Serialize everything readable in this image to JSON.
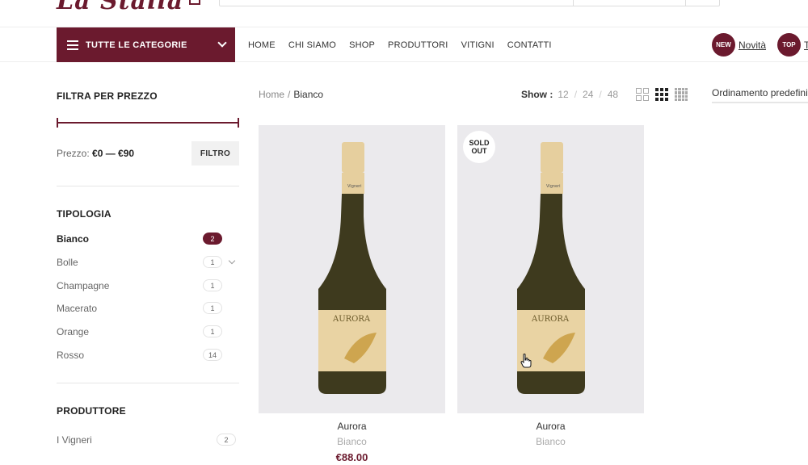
{
  "header": {
    "logo_text": "La Stalla"
  },
  "nav": {
    "categories_label": "TUTTE LE CATEGORIE",
    "menu": [
      "HOME",
      "CHI SIAMO",
      "SHOP",
      "PRODUTTORI",
      "VITIGNI",
      "CONTATTI"
    ],
    "badges": [
      {
        "icon_text": "NEW",
        "label": "Novità"
      },
      {
        "icon_text": "TOP",
        "label": "T"
      }
    ]
  },
  "sidebar": {
    "price_filter": {
      "title": "FILTRA PER PREZZO",
      "label": "Prezzo:",
      "range": "€0 — €90",
      "button": "FILTRO"
    },
    "tipologia": {
      "title": "TIPOLOGIA",
      "items": [
        {
          "label": "Bianco",
          "count": "2",
          "active": true
        },
        {
          "label": "Bolle",
          "count": "1"
        },
        {
          "label": "Champagne",
          "count": "1"
        },
        {
          "label": "Macerato",
          "count": "1"
        },
        {
          "label": "Orange",
          "count": "1"
        },
        {
          "label": "Rosso",
          "count": "14"
        }
      ]
    },
    "produttore": {
      "title": "PRODUTTORE",
      "items": [
        {
          "label": "I Vigneri",
          "count": "2"
        }
      ]
    }
  },
  "toolbar": {
    "breadcrumb_home": "Home",
    "breadcrumb_separator": "/",
    "breadcrumb_current": "Bianco",
    "show_label": "Show :",
    "show_options": [
      "12",
      "24",
      "48"
    ],
    "sort_label": "Ordinamento predefinito"
  },
  "products": [
    {
      "name": "Aurora",
      "category": "Bianco",
      "price": "€88.00",
      "label_text": "AURORA",
      "neck_text": "Vigneri",
      "sold_out": false
    },
    {
      "name": "Aurora",
      "category": "Bianco",
      "price": "",
      "label_text": "AURORA",
      "neck_text": "Vigneri",
      "sold_out": true,
      "badge": "SOLD OUT"
    }
  ],
  "colors": {
    "brand": "#6b1a2e",
    "image_bg": "#ebeaed"
  },
  "icons": [
    "hamburger-icon",
    "chevron-down-icon",
    "grid-2-icon",
    "grid-3-icon",
    "grid-4-icon",
    "hand-cursor-icon"
  ]
}
